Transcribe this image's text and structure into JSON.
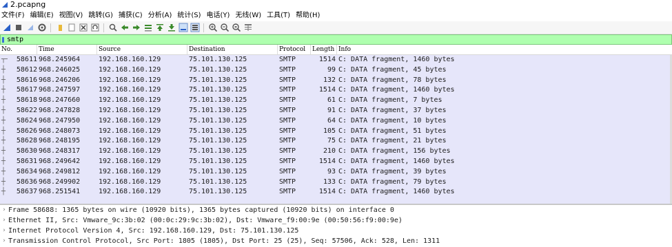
{
  "window": {
    "title": "2.pcapng"
  },
  "menu": [
    "文件(F)",
    "编辑(E)",
    "视图(V)",
    "跳转(G)",
    "捕获(C)",
    "分析(A)",
    "统计(S)",
    "电话(Y)",
    "无线(W)",
    "工具(T)",
    "帮助(H)"
  ],
  "toolbar_icons": [
    "shark-fin-start-icon",
    "stop-icon",
    "restart-icon",
    "options-gear-icon",
    "open-folder-icon",
    "file-icon",
    "close-file-icon",
    "reload-icon",
    "find-icon",
    "go-back-icon",
    "go-forward-icon",
    "go-to-packet-icon",
    "first-packet-icon",
    "last-packet-icon",
    "autoscroll-icon",
    "colorize-icon",
    "zoom-in-icon",
    "zoom-out-icon",
    "zoom-reset-icon",
    "resize-columns-icon"
  ],
  "filter": {
    "value": "smtp"
  },
  "columns": [
    "No.",
    "Time",
    "Source",
    "Destination",
    "Protocol",
    "Length",
    "Info"
  ],
  "packets": [
    {
      "no": "58611",
      "time": "968.245964",
      "src": "192.168.160.129",
      "dst": "75.101.130.125",
      "proto": "SMTP",
      "len": "1514",
      "info": "C: DATA fragment, 1460 bytes"
    },
    {
      "no": "58612",
      "time": "968.246025",
      "src": "192.168.160.129",
      "dst": "75.101.130.125",
      "proto": "SMTP",
      "len": "99",
      "info": "C: DATA fragment, 45 bytes"
    },
    {
      "no": "58616",
      "time": "968.246206",
      "src": "192.168.160.129",
      "dst": "75.101.130.125",
      "proto": "SMTP",
      "len": "132",
      "info": "C: DATA fragment, 78 bytes"
    },
    {
      "no": "58617",
      "time": "968.247597",
      "src": "192.168.160.129",
      "dst": "75.101.130.125",
      "proto": "SMTP",
      "len": "1514",
      "info": "C: DATA fragment, 1460 bytes"
    },
    {
      "no": "58618",
      "time": "968.247660",
      "src": "192.168.160.129",
      "dst": "75.101.130.125",
      "proto": "SMTP",
      "len": "61",
      "info": "C: DATA fragment, 7 bytes"
    },
    {
      "no": "58622",
      "time": "968.247828",
      "src": "192.168.160.129",
      "dst": "75.101.130.125",
      "proto": "SMTP",
      "len": "91",
      "info": "C: DATA fragment, 37 bytes"
    },
    {
      "no": "58624",
      "time": "968.247950",
      "src": "192.168.160.129",
      "dst": "75.101.130.125",
      "proto": "SMTP",
      "len": "64",
      "info": "C: DATA fragment, 10 bytes"
    },
    {
      "no": "58626",
      "time": "968.248073",
      "src": "192.168.160.129",
      "dst": "75.101.130.125",
      "proto": "SMTP",
      "len": "105",
      "info": "C: DATA fragment, 51 bytes"
    },
    {
      "no": "58628",
      "time": "968.248195",
      "src": "192.168.160.129",
      "dst": "75.101.130.125",
      "proto": "SMTP",
      "len": "75",
      "info": "C: DATA fragment, 21 bytes"
    },
    {
      "no": "58630",
      "time": "968.248317",
      "src": "192.168.160.129",
      "dst": "75.101.130.125",
      "proto": "SMTP",
      "len": "210",
      "info": "C: DATA fragment, 156 bytes"
    },
    {
      "no": "58631",
      "time": "968.249642",
      "src": "192.168.160.129",
      "dst": "75.101.130.125",
      "proto": "SMTP",
      "len": "1514",
      "info": "C: DATA fragment, 1460 bytes"
    },
    {
      "no": "58634",
      "time": "968.249812",
      "src": "192.168.160.129",
      "dst": "75.101.130.125",
      "proto": "SMTP",
      "len": "93",
      "info": "C: DATA fragment, 39 bytes"
    },
    {
      "no": "58636",
      "time": "968.249902",
      "src": "192.168.160.129",
      "dst": "75.101.130.125",
      "proto": "SMTP",
      "len": "133",
      "info": "C: DATA fragment, 79 bytes"
    },
    {
      "no": "58637",
      "time": "968.251541",
      "src": "192.168.160.129",
      "dst": "75.101.130.125",
      "proto": "SMTP",
      "len": "1514",
      "info": "C: DATA fragment, 1460 bytes"
    }
  ],
  "details": [
    "Frame 58688: 1365 bytes on wire (10920 bits), 1365 bytes captured (10920 bits) on interface 0",
    "Ethernet II, Src: Vmware_9c:3b:02 (00:0c:29:9c:3b:02), Dst: Vmware_f9:00:9e (00:50:56:f9:00:9e)",
    "Internet Protocol Version 4, Src: 192.168.160.129, Dst: 75.101.130.125",
    "Transmission Control Protocol, Src Port: 1805 (1805), Dst Port: 25 (25), Seq: 57506, Ack: 528, Len: 1311"
  ],
  "colors": {
    "row_bg": "#e6e6fa",
    "filter_bg": "#afffaf",
    "accent": "#3a6fd8"
  }
}
